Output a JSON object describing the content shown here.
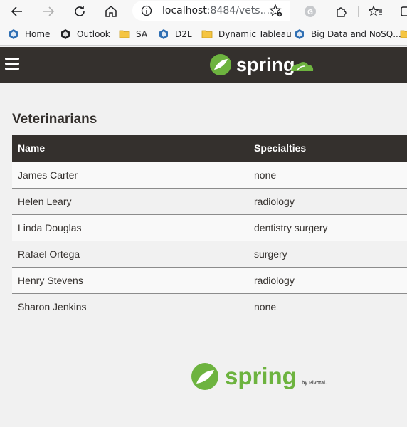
{
  "browser": {
    "url_host": "localhost",
    "url_rest": ":8484/vets....",
    "icons": [
      "back-icon",
      "forward-icon",
      "reload-icon",
      "home-icon",
      "info-icon",
      "add-favorite-icon",
      "grammarly-icon",
      "extensions-icon",
      "favorites-icon",
      "collections-icon"
    ]
  },
  "bookmarks": [
    {
      "label": "Home",
      "icon": "blue-cube-icon"
    },
    {
      "label": "Outlook",
      "icon": "black-cube-icon"
    },
    {
      "label": "SA",
      "icon": "folder-icon"
    },
    {
      "label": "D2L",
      "icon": "blue-cube-icon"
    },
    {
      "label": "Dynamic Tableau",
      "icon": "folder-icon"
    },
    {
      "label": "Big Data and NoSQ...",
      "icon": "blue-cube-icon"
    }
  ],
  "app": {
    "brand": "spring",
    "footer_brand": "spring",
    "footer_by": "by Pivotal.",
    "colors": {
      "navbar": "#34302d",
      "green": "#6db33f"
    }
  },
  "page": {
    "title": "Veterinarians",
    "columns": [
      "Name",
      "Specialties"
    ],
    "rows": [
      {
        "name": "James Carter",
        "specialties": "none"
      },
      {
        "name": "Helen Leary",
        "specialties": "radiology"
      },
      {
        "name": "Linda Douglas",
        "specialties": "dentistry surgery"
      },
      {
        "name": "Rafael Ortega",
        "specialties": "surgery"
      },
      {
        "name": "Henry Stevens",
        "specialties": "radiology"
      },
      {
        "name": "Sharon Jenkins",
        "specialties": "none"
      }
    ]
  }
}
